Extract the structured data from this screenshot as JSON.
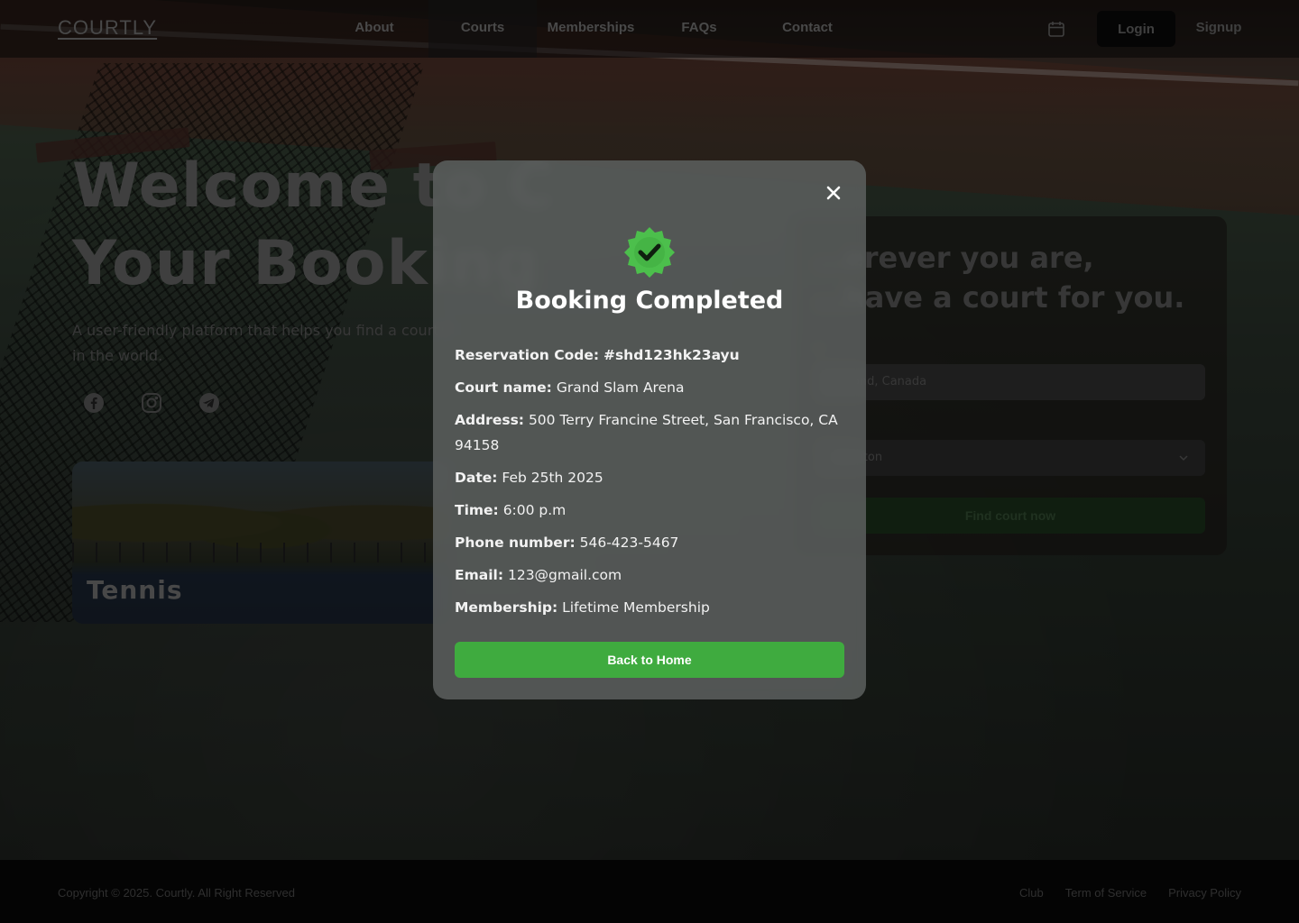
{
  "header": {
    "logo": "COURTLY",
    "nav": [
      {
        "label": "About"
      },
      {
        "label": "Courts"
      },
      {
        "label": "Memberships"
      },
      {
        "label": "FAQs"
      },
      {
        "label": "Contact"
      }
    ],
    "calendar_icon": "calendar-icon",
    "login_label": "Login",
    "signup_label": "Signup"
  },
  "hero": {
    "title_line1": "Welcome to C",
    "title_line2": "Your Booking",
    "subtitle_line1": "A user-friendly platform that helps you find a court f",
    "subtitle_line2": "in the world.",
    "socials": [
      "facebook-icon",
      "instagram-icon",
      "telegram-icon"
    ],
    "card_label": "Tennis"
  },
  "search_panel": {
    "title_line1": "…erever you are,",
    "title_line2": "…have a court for you.",
    "location_label": "n",
    "location_value": "hmond, Canada",
    "sport_value": "dminton",
    "find_label": "Find court now"
  },
  "modal": {
    "title": "Booking Completed",
    "badge_icon": "check-badge-icon",
    "close_icon": "close-icon",
    "details": [
      {
        "label": "Reservation Code:",
        "value": "#shd123hk23ayu"
      },
      {
        "label": "Court name:",
        "value": "Grand Slam Arena"
      },
      {
        "label": "Address:",
        "value": "500 Terry Francine Street, San Francisco, CA 94158"
      },
      {
        "label": "Date:",
        "value": "Feb 25th 2025"
      },
      {
        "label": "Time:",
        "value": "6:00 p.m"
      },
      {
        "label": "Phone number:",
        "value": "546-423-5467"
      },
      {
        "label": "Email:",
        "value": "123@gmail.com"
      },
      {
        "label": "Membership:",
        "value": "Lifetime Membership"
      }
    ],
    "button_label": "Back to Home"
  },
  "footer": {
    "copyright": "Copyright © 2025. Courtly. All Right Reserved",
    "links": [
      "Club",
      "Term of Service",
      "Privacy Policy"
    ]
  },
  "colors": {
    "accent_green": "#3fab3f",
    "badge_green": "#4cbf4c"
  }
}
